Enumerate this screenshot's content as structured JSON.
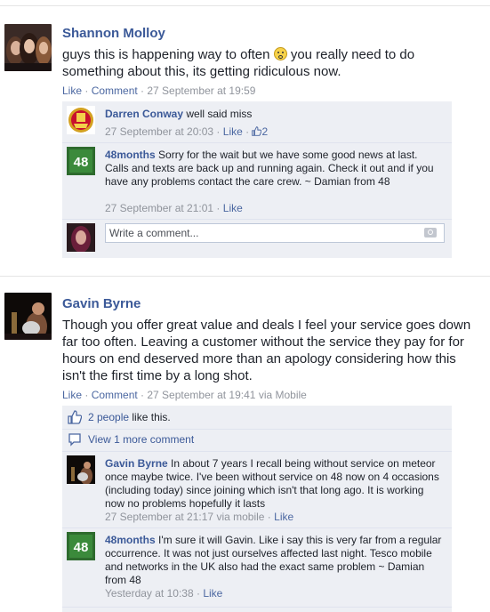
{
  "posts": [
    {
      "author": "Shannon Molloy",
      "text_before": "guys this is happening way to often ",
      "text_after": " you really need to do something about this, its getting ridiculous now.",
      "like": "Like",
      "comment": "Comment",
      "time": "27 September at 19:59",
      "comments": [
        {
          "author": "Darren Conway",
          "text": "well said miss",
          "time": "27 September at 20:03",
          "like": "Like",
          "likes": "2"
        },
        {
          "author": "48months",
          "text": "Sorry for the wait but we have some good news at last. Calls and texts are back up and running again. Check it out and if you have any problems contact the care crew. ~ Damian from 48",
          "time": "27 September at 21:01",
          "like": "Like"
        }
      ],
      "write_placeholder": "Write a comment..."
    },
    {
      "author": "Gavin Byrne",
      "text": "Though you offer great value and deals I feel your service goes down far too often. Leaving a customer without the service they pay for for hours on end deserved more than an apology considering how this isn't the first time by a long shot.",
      "like": "Like",
      "comment": "Comment",
      "time": "27 September at 19:41",
      "via": "via Mobile",
      "likes_people": "2 people",
      "likes_suffix": "like this.",
      "view_more": "View 1 more comment",
      "comments": [
        {
          "author": "Gavin Byrne",
          "text": "In about 7 years I recall being without service on meteor once maybe twice. I've been without service on 48 now on 4 occasions (including today) since joining which isn't that long ago. It is working now no problems hopefully it lasts",
          "time": "27 September at 21:17",
          "via": "via mobile",
          "like": "Like"
        },
        {
          "author": "48months",
          "text": "I'm sure it will Gavin. Like i say this is very far from a regular occurrence. It was not just ourselves affected last night. Tesco mobile and networks in the UK also had the exact same problem ~ Damian from 48",
          "time": "Yesterday at 10:38",
          "like": "Like"
        }
      ]
    }
  ],
  "sep": " · ",
  "colors": {
    "link": "#3b5998",
    "meta": "#90949c",
    "box": "#edeff4",
    "brand48": "#3b8a3b"
  }
}
